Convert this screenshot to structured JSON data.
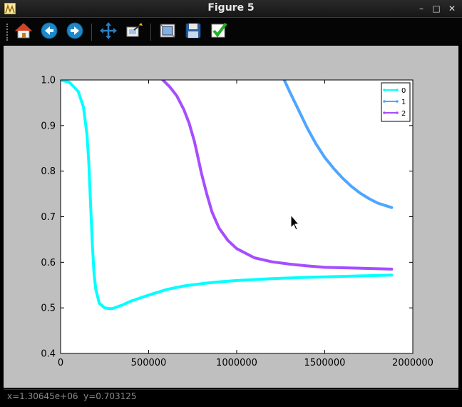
{
  "window": {
    "title": "Figure 5"
  },
  "window_controls": {
    "minimize": "–",
    "maximize": "□",
    "close": "✕"
  },
  "toolbar": {
    "buttons": [
      {
        "name": "home-button",
        "icon": "home-icon"
      },
      {
        "name": "back-button",
        "icon": "arrow-left-icon"
      },
      {
        "name": "forward-button",
        "icon": "arrow-right-icon"
      },
      {
        "name": "pan-button",
        "icon": "move-icon"
      },
      {
        "name": "zoom-button",
        "icon": "zoom-rect-icon"
      },
      {
        "name": "subplots-button",
        "icon": "subplots-icon"
      },
      {
        "name": "save-button",
        "icon": "floppy-disk-icon"
      },
      {
        "name": "edit-button",
        "icon": "checkmark-icon"
      }
    ]
  },
  "status_bar": {
    "text": "x=1.30645e+06  y=0.703125"
  },
  "chart_data": {
    "type": "line",
    "title": "",
    "xlabel": "",
    "ylabel": "",
    "xlim": [
      0,
      2000000
    ],
    "ylim": [
      0.4,
      1.0
    ],
    "x_ticks": [
      "0",
      "500000",
      "1000000",
      "1500000",
      "2000000"
    ],
    "y_ticks": [
      "0.4",
      "0.5",
      "0.6",
      "0.7",
      "0.8",
      "0.9",
      "1.0"
    ],
    "grid": false,
    "legend_position": "top-right",
    "series": [
      {
        "name": "0",
        "color": "#00ffff",
        "x": [
          0,
          50000,
          100000,
          130000,
          150000,
          160000,
          170000,
          180000,
          190000,
          200000,
          220000,
          250000,
          280000,
          300000,
          350000,
          400000,
          500000,
          600000,
          700000,
          800000,
          900000,
          1000000,
          1200000,
          1400000,
          1600000,
          1880000
        ],
        "y": [
          1.0,
          0.995,
          0.975,
          0.94,
          0.88,
          0.82,
          0.73,
          0.64,
          0.575,
          0.54,
          0.51,
          0.5,
          0.498,
          0.499,
          0.506,
          0.515,
          0.528,
          0.54,
          0.548,
          0.553,
          0.557,
          0.56,
          0.564,
          0.567,
          0.569,
          0.572
        ]
      },
      {
        "name": "1",
        "color": "#4da6ff",
        "x": [
          1270000,
          1300000,
          1350000,
          1400000,
          1450000,
          1500000,
          1550000,
          1600000,
          1650000,
          1700000,
          1750000,
          1800000,
          1880000
        ],
        "y": [
          1.0,
          0.975,
          0.935,
          0.895,
          0.86,
          0.83,
          0.806,
          0.785,
          0.767,
          0.752,
          0.74,
          0.73,
          0.72
        ]
      },
      {
        "name": "2",
        "color": "#a64dff",
        "x": [
          580000,
          620000,
          660000,
          700000,
          730000,
          760000,
          780000,
          800000,
          830000,
          860000,
          900000,
          950000,
          1000000,
          1100000,
          1200000,
          1300000,
          1400000,
          1500000,
          1600000,
          1700000,
          1880000
        ],
        "y": [
          1.0,
          0.985,
          0.965,
          0.935,
          0.905,
          0.865,
          0.83,
          0.795,
          0.75,
          0.71,
          0.675,
          0.648,
          0.63,
          0.61,
          0.601,
          0.596,
          0.592,
          0.589,
          0.588,
          0.587,
          0.585
        ]
      }
    ]
  }
}
